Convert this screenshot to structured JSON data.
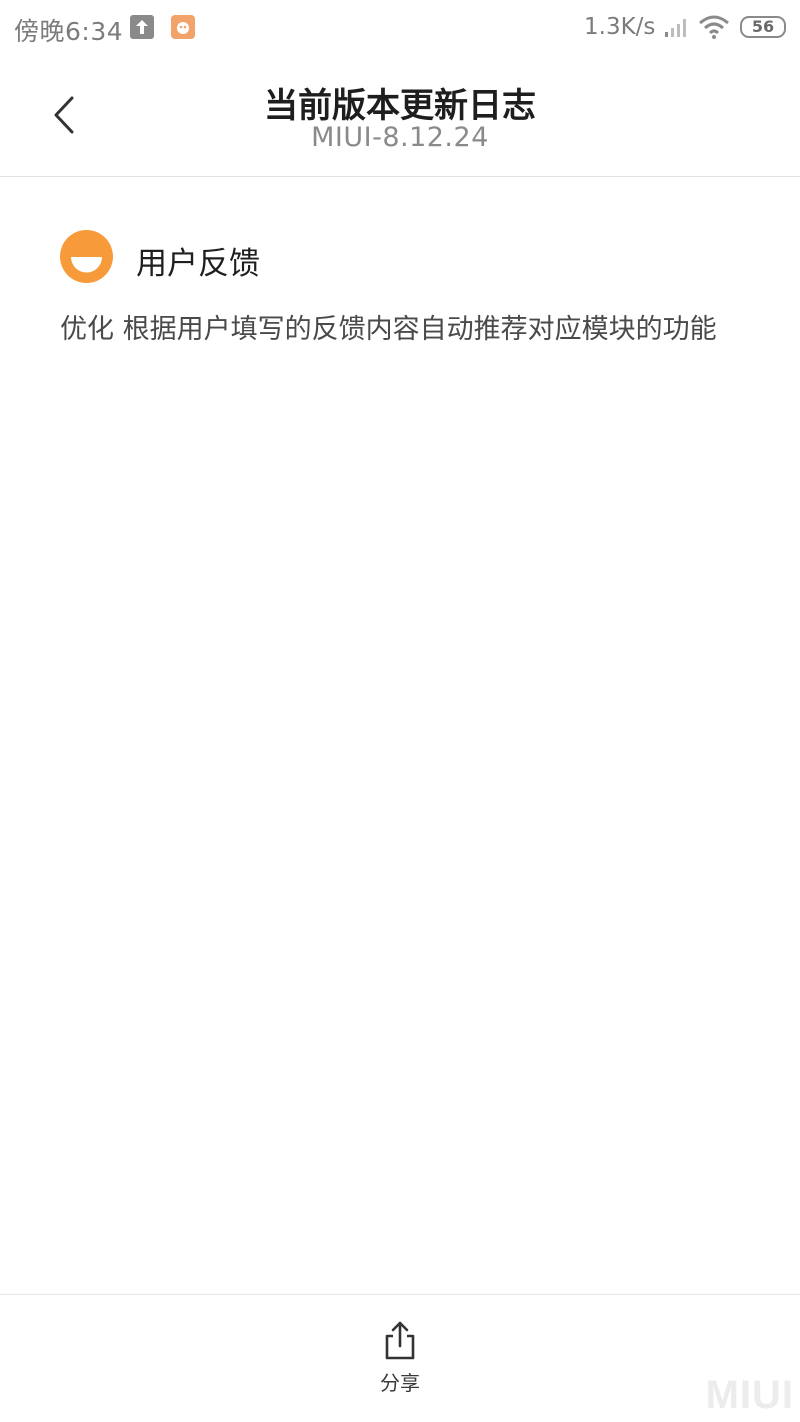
{
  "status_bar": {
    "time": "傍晚6:34",
    "net_speed": "1.3K/s",
    "battery": "56",
    "icons": [
      "upload-icon",
      "app-notification-icon",
      "signal-icon",
      "wifi-icon",
      "battery-icon"
    ]
  },
  "header": {
    "title": "当前版本更新日志",
    "version": "MIUI-8.12.24"
  },
  "section": {
    "title": "用户反馈",
    "icon": "feedback-face-icon",
    "accent_color": "#f79a39",
    "description": "优化 根据用户填写的反馈内容自动推荐对应模块的功能"
  },
  "footer": {
    "share_label": "分享",
    "share_icon": "share-icon"
  },
  "watermark": "MIUI"
}
